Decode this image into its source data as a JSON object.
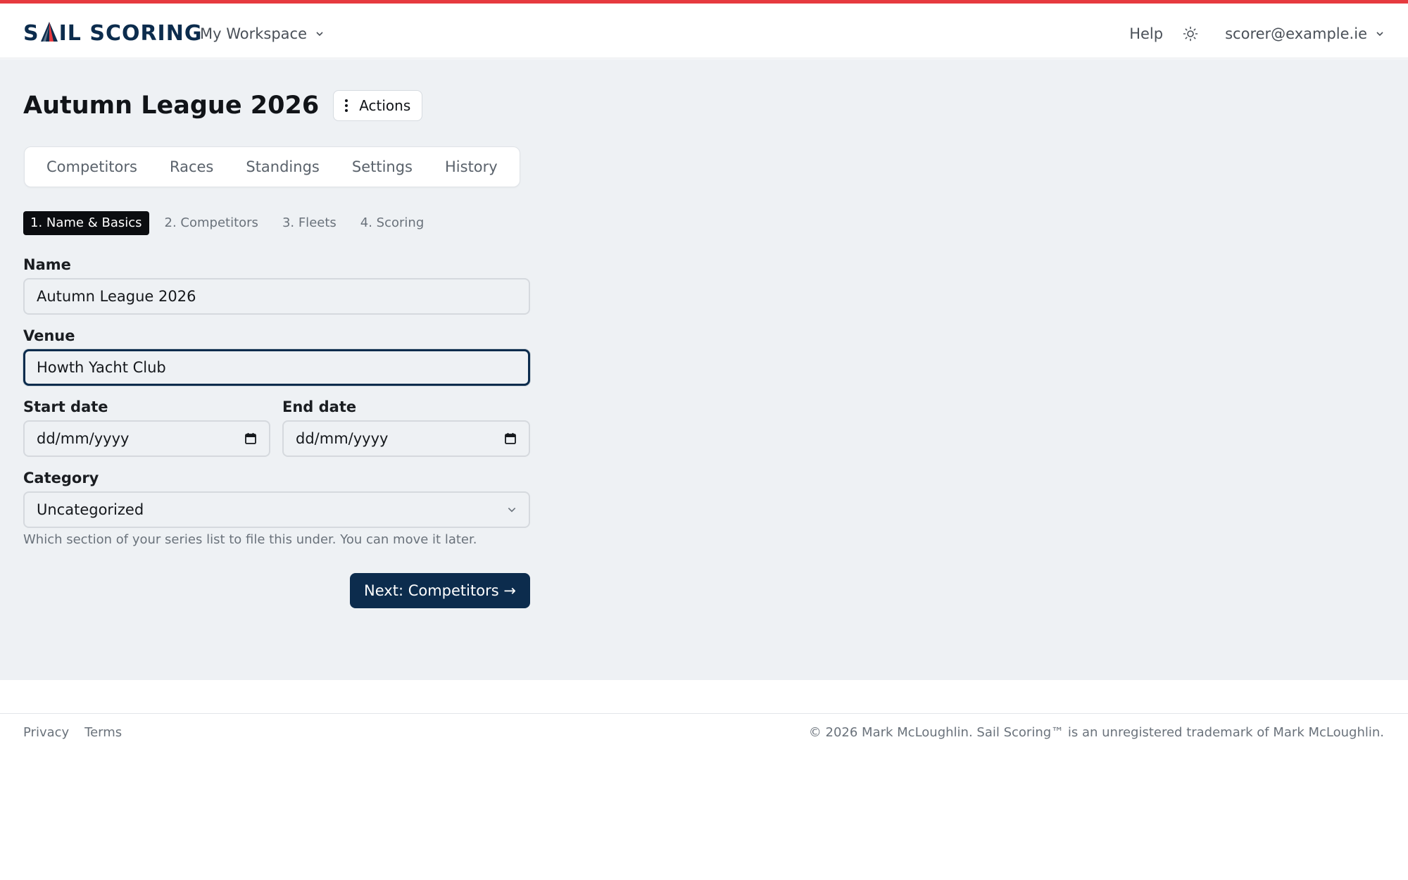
{
  "brand": {
    "logo_left": "S",
    "logo_right": "IL SCORING",
    "accent_color": "#e63a3f",
    "primary_color": "#0c2c4d"
  },
  "navbar": {
    "workspace_label": "My Workspace",
    "help_label": "Help",
    "theme_icon": "sun-icon",
    "user_email": "scorer@example.ie"
  },
  "page": {
    "title": "Autumn League 2026",
    "actions_label": "Actions"
  },
  "tabs": [
    {
      "label": "Competitors"
    },
    {
      "label": "Races"
    },
    {
      "label": "Standings"
    },
    {
      "label": "Settings"
    },
    {
      "label": "History"
    }
  ],
  "steps": [
    {
      "label": "1. Name & Basics",
      "active": true
    },
    {
      "label": "2. Competitors",
      "active": false
    },
    {
      "label": "3. Fleets",
      "active": false
    },
    {
      "label": "4. Scoring",
      "active": false
    }
  ],
  "form": {
    "name_label": "Name",
    "name_value": "Autumn League 2026",
    "venue_label": "Venue",
    "venue_value": "Howth Yacht Club",
    "start_date_label": "Start date",
    "start_date_placeholder": "dd/mm/yyyy",
    "end_date_label": "End date",
    "end_date_placeholder": "dd/mm/yyyy",
    "category_label": "Category",
    "category_value": "Uncategorized",
    "category_hint": "Which section of your series list to file this under. You can move it later.",
    "next_button": "Next: Competitors →"
  },
  "footer": {
    "privacy": "Privacy",
    "terms": "Terms",
    "copyright": "© 2026 Mark McLoughlin. Sail Scoring™ is an unregistered trademark of Mark McLoughlin."
  }
}
